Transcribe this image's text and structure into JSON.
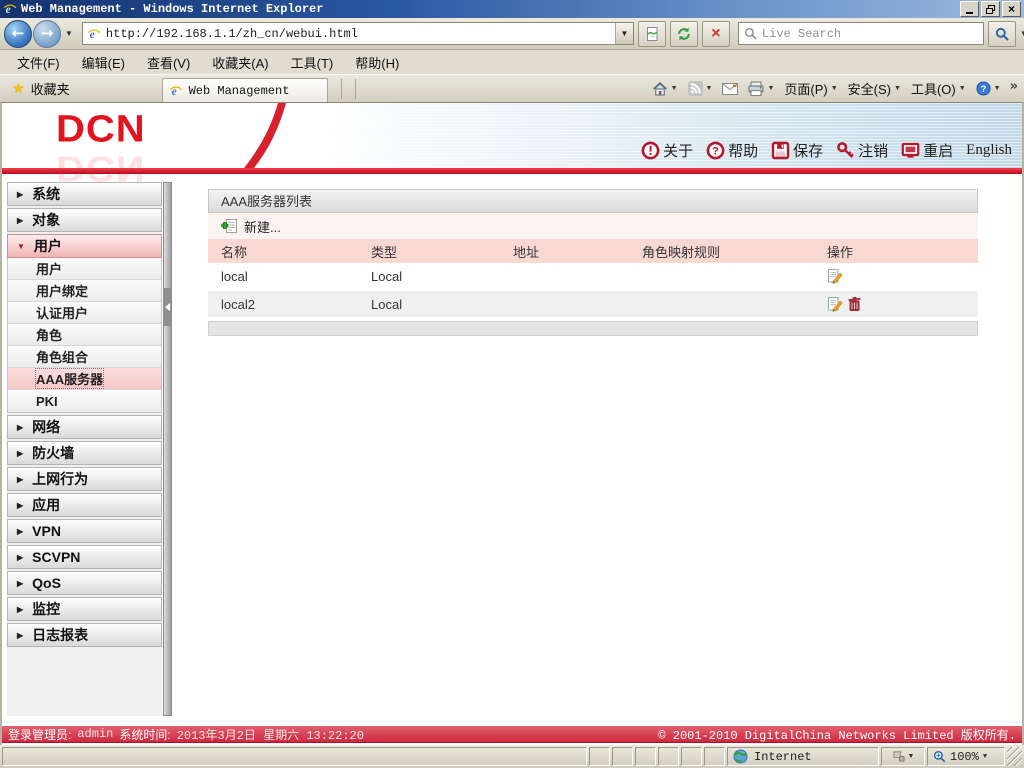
{
  "window": {
    "title": "Web Management - Windows Internet Explorer",
    "url": "http://192.168.1.1/zh_cn/webui.html",
    "search_placeholder": "Live Search"
  },
  "menu": {
    "items": [
      {
        "label": "文件(F)"
      },
      {
        "label": "编辑(E)"
      },
      {
        "label": "查看(V)"
      },
      {
        "label": "收藏夹(A)"
      },
      {
        "label": "工具(T)"
      },
      {
        "label": "帮助(H)"
      }
    ]
  },
  "favorites": {
    "label": "收藏夹",
    "tab": "Web Management",
    "page_menu": "页面(P)",
    "safety_menu": "安全(S)",
    "tools_menu": "工具(O)"
  },
  "header": {
    "logo": "DCN",
    "about": "关于",
    "help": "帮助",
    "save": "保存",
    "logout": "注销",
    "restart": "重启",
    "language": "English"
  },
  "sidebar": {
    "items": [
      {
        "label": "系统"
      },
      {
        "label": "对象"
      },
      {
        "label": "用户",
        "expanded": true
      },
      {
        "label": "网络"
      },
      {
        "label": "防火墙"
      },
      {
        "label": "上网行为"
      },
      {
        "label": "应用"
      },
      {
        "label": "VPN"
      },
      {
        "label": "SCVPN"
      },
      {
        "label": "QoS"
      },
      {
        "label": "监控"
      },
      {
        "label": "日志报表"
      }
    ],
    "user_children": [
      {
        "label": "用户"
      },
      {
        "label": "用户绑定"
      },
      {
        "label": "认证用户"
      },
      {
        "label": "角色"
      },
      {
        "label": "角色组合"
      },
      {
        "label": "AAA服务器",
        "selected": true
      },
      {
        "label": "PKI"
      }
    ]
  },
  "panel": {
    "title": "AAA服务器列表",
    "new_button": "新建...",
    "columns": {
      "name": "名称",
      "type": "类型",
      "address": "地址",
      "role_mapping": "角色映射规则",
      "actions": "操作"
    },
    "rows": [
      {
        "name": "local",
        "type": "Local",
        "address": "",
        "role_mapping": ""
      },
      {
        "name": "local2",
        "type": "Local",
        "address": "",
        "role_mapping": ""
      }
    ]
  },
  "footer": {
    "admin_label": "登录管理员:",
    "admin": "admin",
    "time_label": "系统时间:",
    "datetime": "2013年3月2日 星期六 13:22:20",
    "copyright": "© 2001-2010 DigitalChina Networks Limited 版权所有."
  },
  "statusbar": {
    "zone": "Internet",
    "zoom": "100%"
  },
  "icons": {
    "back": "←",
    "forward": "→",
    "dropdown": "▼",
    "close": "×",
    "stop": "×",
    "star": "★",
    "overflow": "»",
    "collapsed": "▶",
    "expanded": "▼"
  },
  "colors": {
    "brand_red": "#e2131f",
    "footer_red": "#ce2940",
    "table_header_pink": "#f9d8d4"
  }
}
